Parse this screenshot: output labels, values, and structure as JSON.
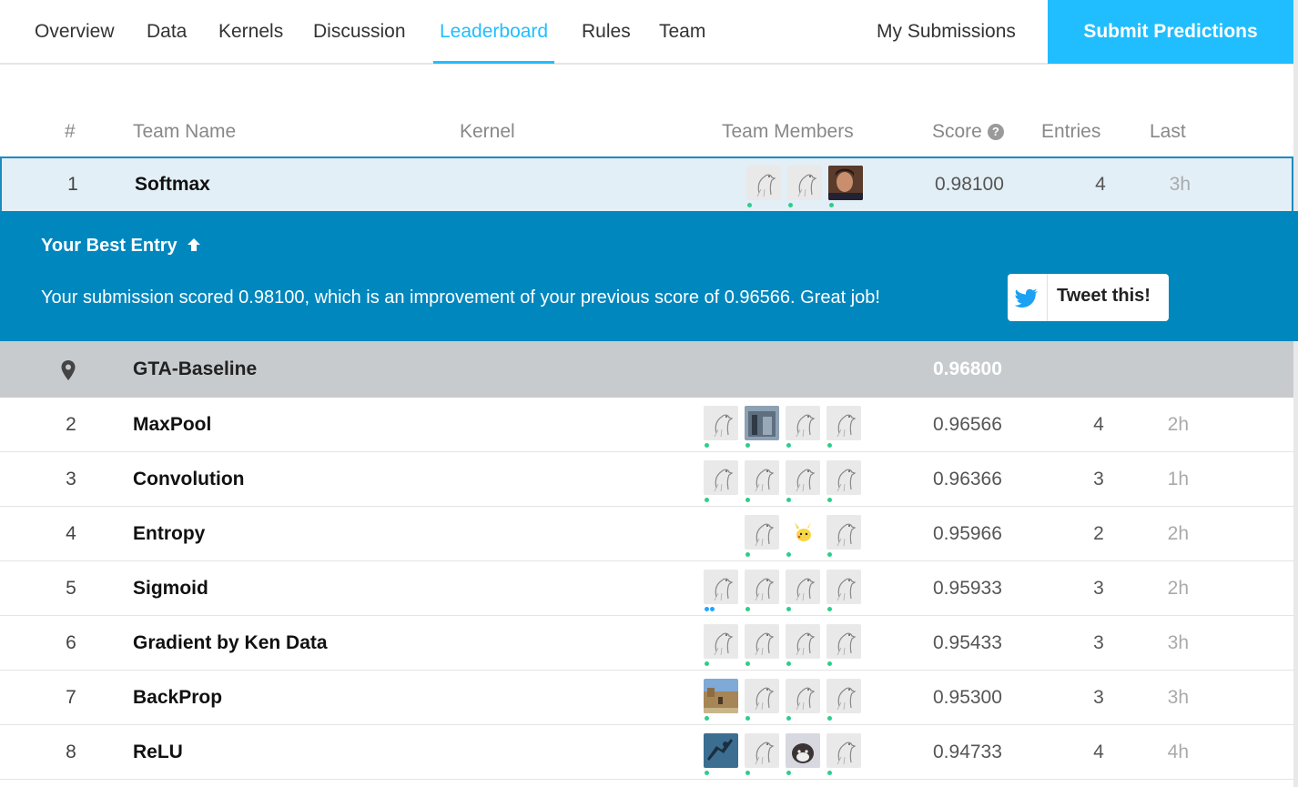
{
  "nav": {
    "tabs": [
      {
        "label": "Overview"
      },
      {
        "label": "Data"
      },
      {
        "label": "Kernels"
      },
      {
        "label": "Discussion"
      },
      {
        "label": "Leaderboard",
        "active": true
      },
      {
        "label": "Rules"
      },
      {
        "label": "Team"
      }
    ],
    "my_submissions": "My Submissions",
    "submit_predictions": "Submit Predictions"
  },
  "table": {
    "headers": {
      "rank": "#",
      "team_name": "Team Name",
      "kernel": "Kernel",
      "team_members": "Team Members",
      "score": "Score",
      "entries": "Entries",
      "last": "Last"
    },
    "score_help_icon": "help-icon",
    "rows": [
      {
        "rank": "1",
        "team": "Softmax",
        "score": "0.98100",
        "entries": "4",
        "last": "3h",
        "members": [
          "goose-avatar",
          "goose-avatar",
          "photo-avatar-person"
        ]
      },
      {
        "rank": "2",
        "team": "MaxPool",
        "score": "0.96566",
        "entries": "4",
        "last": "2h",
        "members": [
          "goose-avatar",
          "photo-avatar-building",
          "goose-avatar",
          "goose-avatar"
        ]
      },
      {
        "rank": "3",
        "team": "Convolution",
        "score": "0.96366",
        "entries": "3",
        "last": "1h",
        "members": [
          "goose-avatar",
          "goose-avatar",
          "goose-avatar",
          "goose-avatar"
        ]
      },
      {
        "rank": "4",
        "team": "Entropy",
        "score": "0.95966",
        "entries": "2",
        "last": "2h",
        "members": [
          "goose-avatar",
          "pikachu-avatar",
          "goose-avatar"
        ]
      },
      {
        "rank": "5",
        "team": "Sigmoid",
        "score": "0.95933",
        "entries": "3",
        "last": "2h",
        "members": [
          "goose-avatar",
          "goose-avatar",
          "goose-avatar",
          "goose-avatar"
        ]
      },
      {
        "rank": "6",
        "team": "Gradient by Ken Data",
        "score": "0.95433",
        "entries": "3",
        "last": "3h",
        "members": [
          "goose-avatar",
          "goose-avatar",
          "goose-avatar",
          "goose-avatar"
        ]
      },
      {
        "rank": "7",
        "team": "BackProp",
        "score": "0.95300",
        "entries": "3",
        "last": "3h",
        "members": [
          "photo-avatar-castle",
          "goose-avatar",
          "goose-avatar",
          "goose-avatar"
        ]
      },
      {
        "rank": "8",
        "team": "ReLU",
        "score": "0.94733",
        "entries": "4",
        "last": "4h",
        "members": [
          "photo-avatar-jump",
          "goose-avatar",
          "photo-avatar-dog",
          "goose-avatar"
        ]
      }
    ],
    "baseline": {
      "icon": "map-pin-icon",
      "team": "GTA-Baseline",
      "score": "0.96800"
    }
  },
  "best_entry": {
    "title": "Your Best Entry",
    "title_icon": "arrow-up-icon",
    "message": "Your submission scored 0.98100, which is an improvement of your previous score of 0.96566. Great job!",
    "tweet_label": "Tweet this!",
    "tweet_icon": "twitter-bird-icon"
  },
  "colors": {
    "accent": "#20beff",
    "banner": "#0087be",
    "baseline_row": "#c7cbce",
    "highlight_row": "#e3eff6",
    "online_dot": "#2cce8b"
  }
}
